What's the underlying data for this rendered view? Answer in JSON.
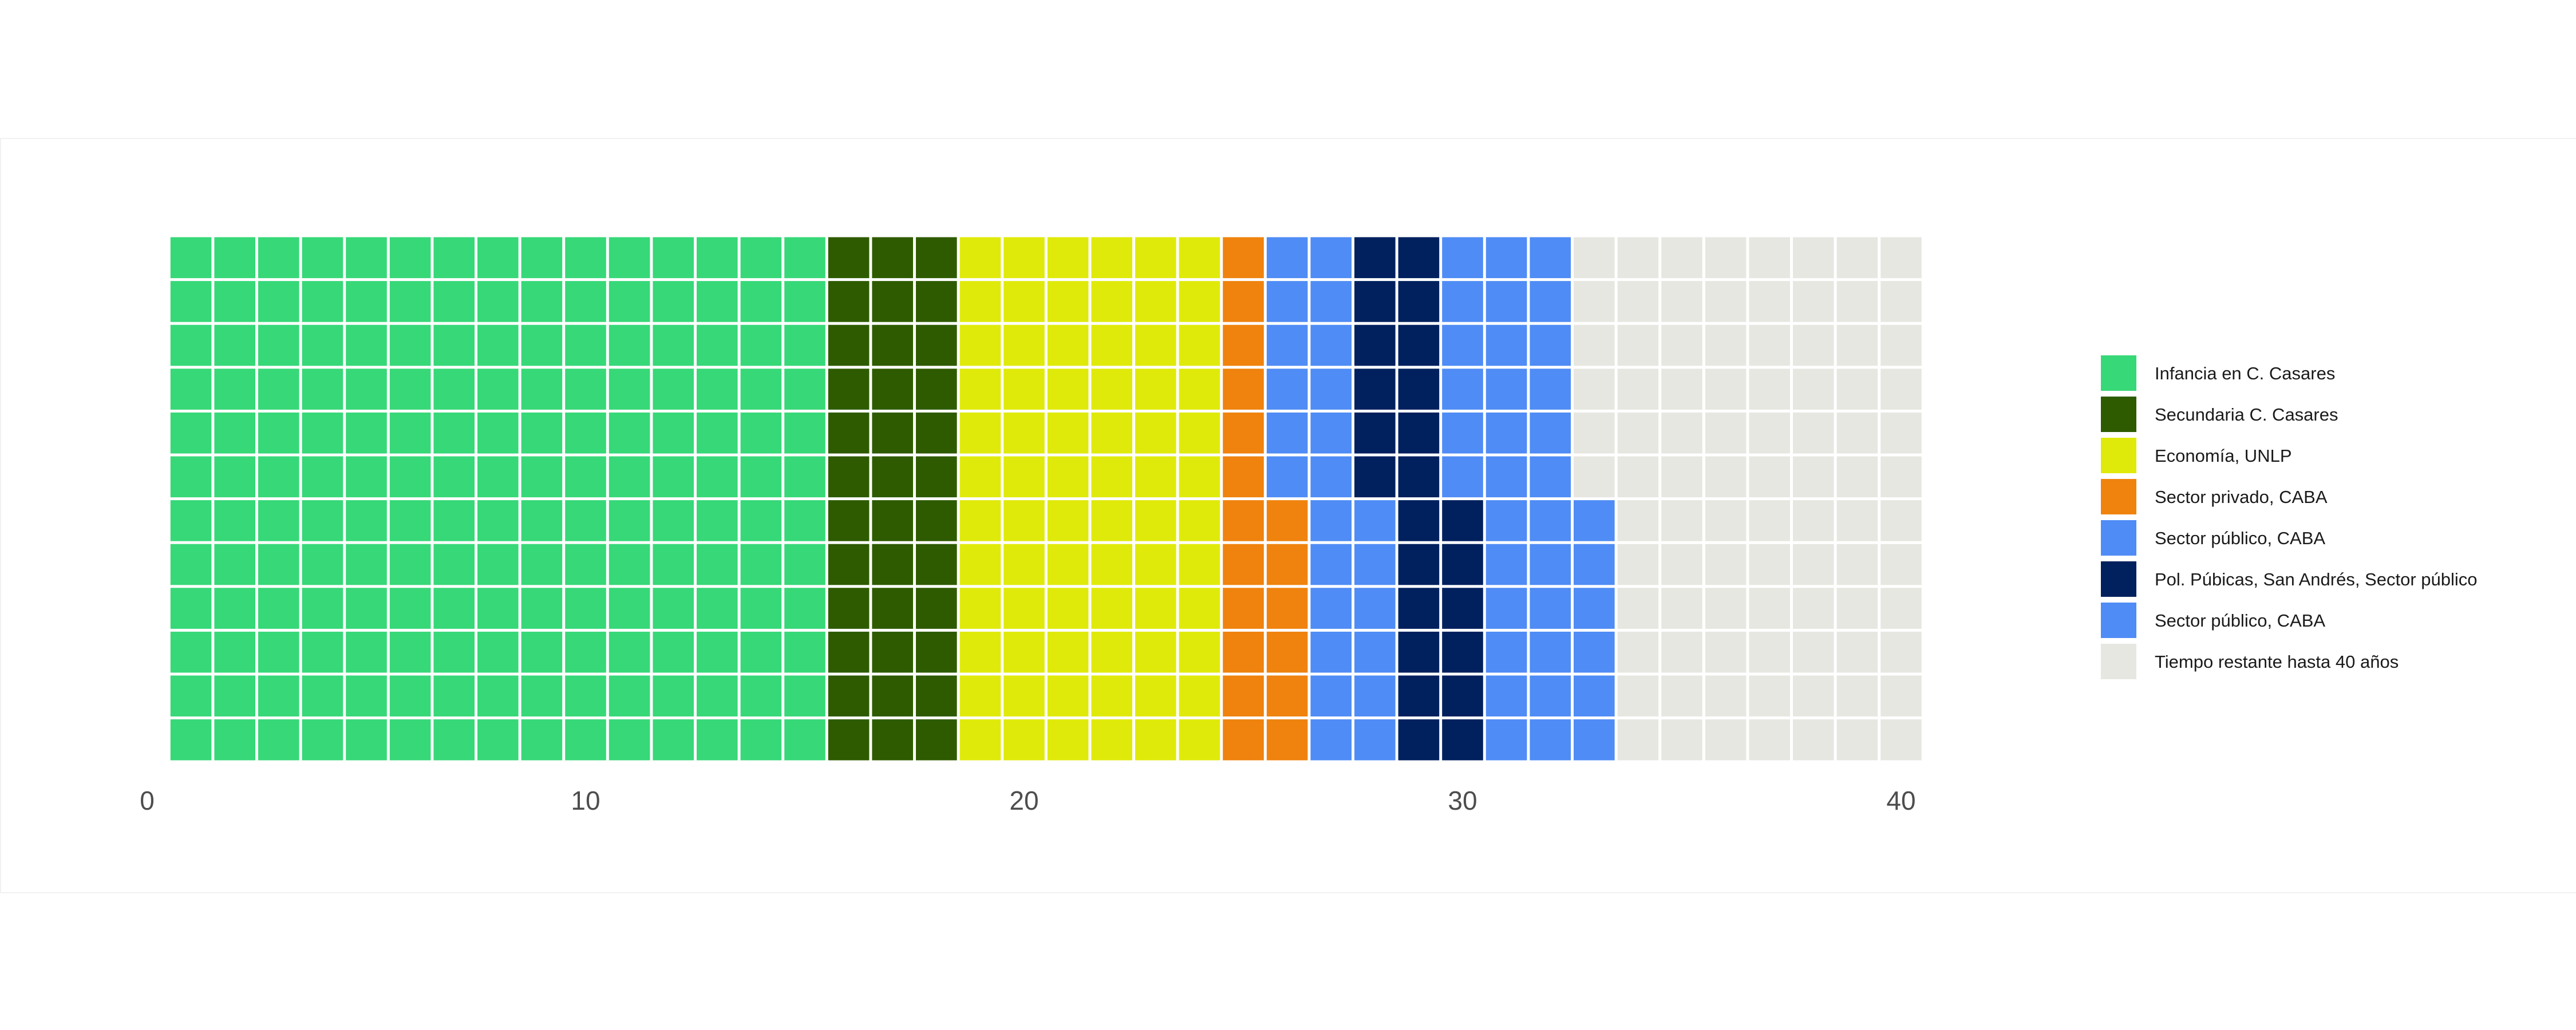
{
  "chart_data": {
    "type": "heatmap",
    "subtype": "waffle",
    "rows": 12,
    "unit": "months",
    "x_axis": {
      "range": [
        0,
        41
      ],
      "ticks": [
        0,
        10,
        20,
        30,
        40
      ],
      "tick_labels": [
        "0",
        "10",
        "20",
        "30",
        "40"
      ]
    },
    "grid": false,
    "legend_position": "right",
    "series": [
      {
        "name": "Infancia en C. Casares",
        "months": 180,
        "color": "#37D878"
      },
      {
        "name": "Secundaria C. Casares",
        "months": 36,
        "color": "#2E5B00"
      },
      {
        "name": "Economía, UNLP",
        "months": 72,
        "color": "#E0EA0A"
      },
      {
        "name": "Sector privado, CABA",
        "months": 18,
        "color": "#EF830E"
      },
      {
        "name": "Sector público, CABA",
        "months": 24,
        "color": "#4F8CF5"
      },
      {
        "name": "Pol. Púbicas, San Andrés, Sector público",
        "months": 24,
        "color": "#00205E"
      },
      {
        "name": "Sector público, CABA",
        "months": 36,
        "color": "#4F8CF5"
      },
      {
        "name": "Tiempo restante hasta 40 años",
        "months": 90,
        "color": "#E7E7E2"
      }
    ]
  }
}
